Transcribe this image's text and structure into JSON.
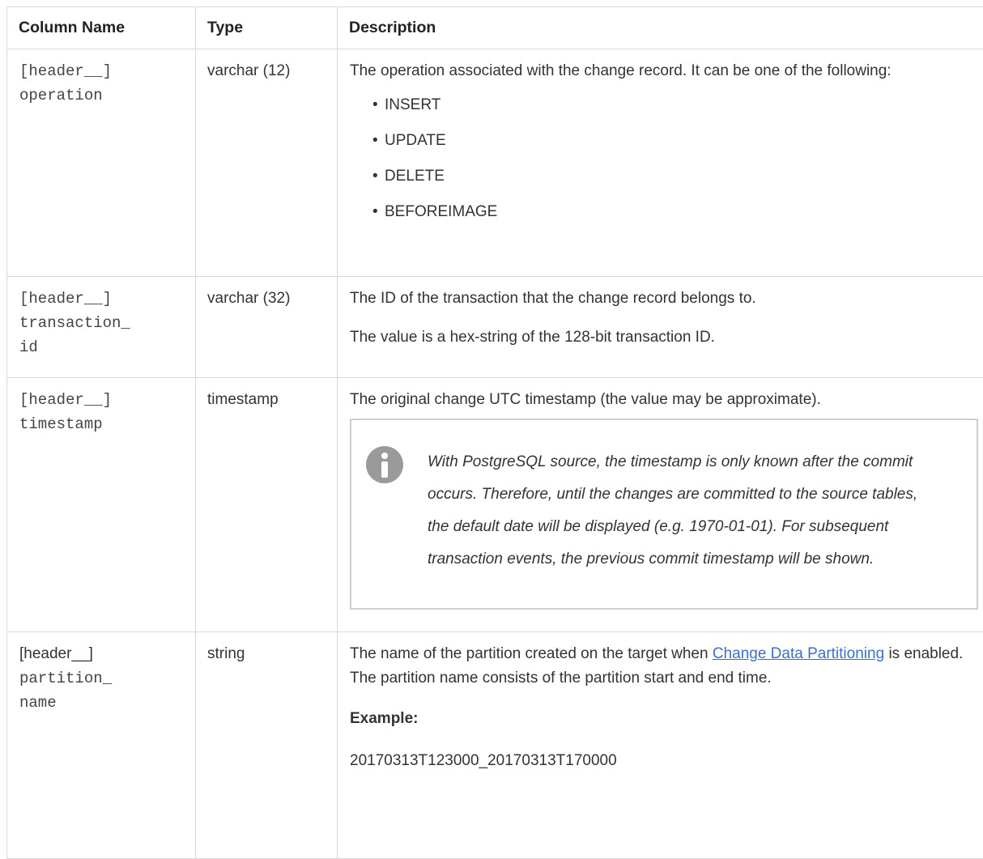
{
  "table": {
    "headers": [
      "Column Name",
      "Type",
      "Description"
    ],
    "rows": [
      {
        "name_line1": "[header__]",
        "name_line2": "operation",
        "type": "varchar (12)",
        "description": "The operation associated with the change record. It can be one of the following:",
        "operations": [
          "INSERT",
          "UPDATE",
          "DELETE",
          "BEFOREIMAGE"
        ]
      },
      {
        "name_line1": "[header__]",
        "name_line2": "transaction_",
        "name_line3": "id",
        "type": "varchar (32)",
        "description": "The ID of the transaction that the change record belongs to.",
        "description2": "The value is a hex-string of the 128-bit transaction ID."
      },
      {
        "name_line1": "[header__]",
        "name_line2": "timestamp",
        "type": "timestamp",
        "description": "The original change UTC timestamp (the value may be approximate).",
        "note": "With PostgreSQL source, the timestamp is only known after the commit occurs. Therefore, until the changes are committed to the source tables, the default date will be displayed (e.g. 1970-01-01). For subsequent transaction events, the previous commit timestamp will be shown."
      },
      {
        "name_line1": "[header__]",
        "name_line2": "partition_",
        "name_line3": "name",
        "type": "string",
        "description_before": "The name of the partition created on the target when",
        "link": "Change Data Partitioning",
        "description_after": "is enabled. The partition name consists of the partition start and end time.",
        "example_label": "Example:",
        "example_value": "20170313T123000_20170313T170000"
      }
    ]
  }
}
